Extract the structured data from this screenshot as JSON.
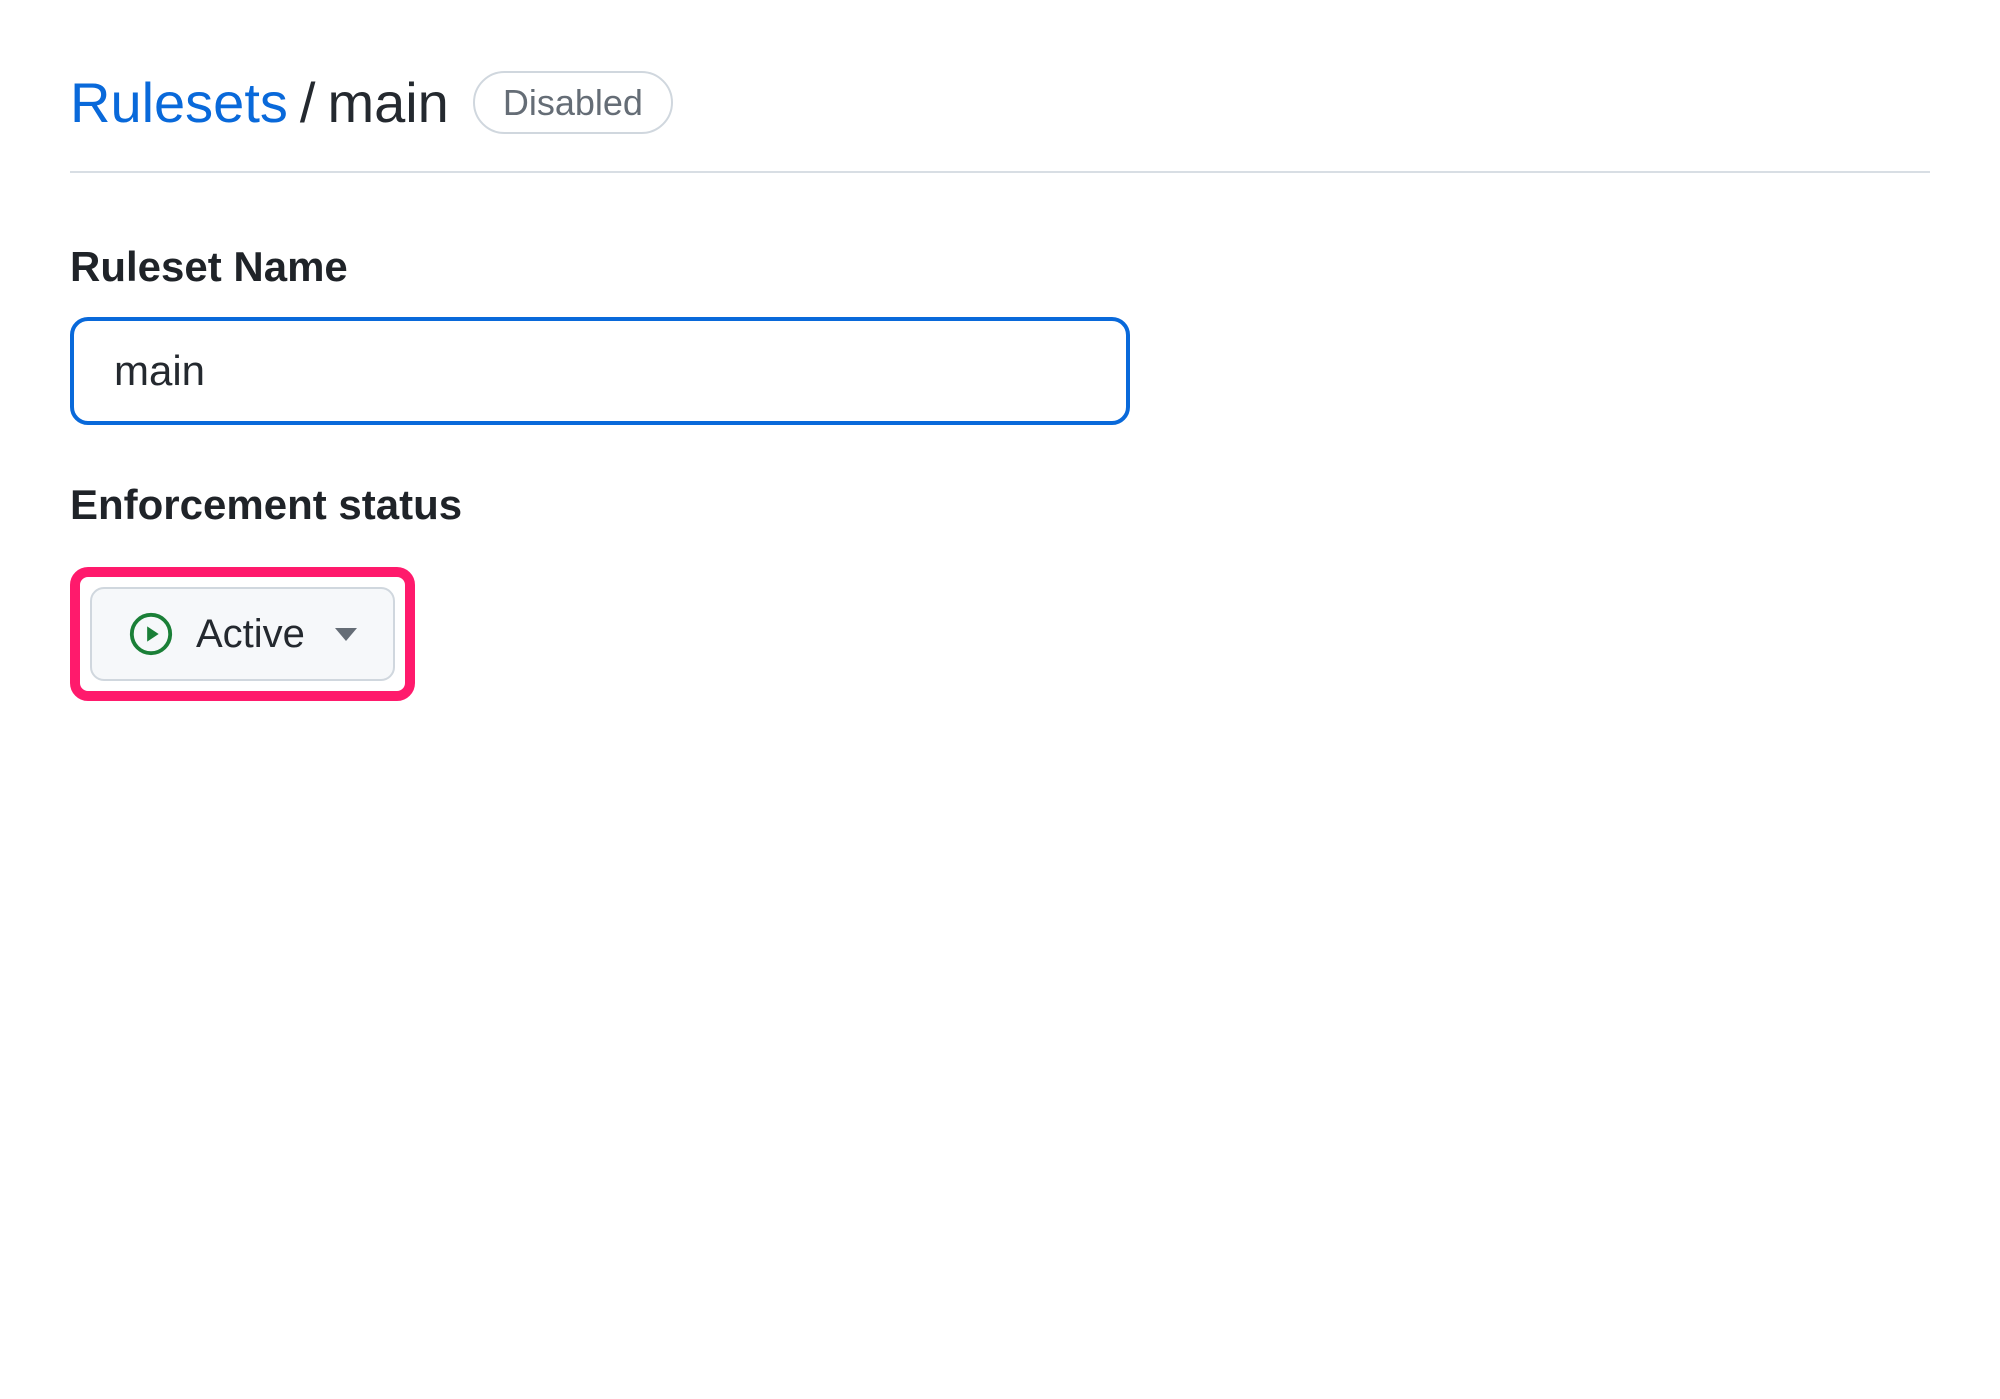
{
  "breadcrumb": {
    "parent_label": "Rulesets",
    "separator": "/",
    "current_label": "main"
  },
  "status_badge": {
    "label": "Disabled"
  },
  "fields": {
    "ruleset_name": {
      "label": "Ruleset Name",
      "value": "main"
    },
    "enforcement_status": {
      "label": "Enforcement status",
      "selected": "Active"
    }
  },
  "colors": {
    "accent_blue": "#0969da",
    "highlight_pink": "#ff1a6c",
    "success_green": "#1a7f37"
  }
}
